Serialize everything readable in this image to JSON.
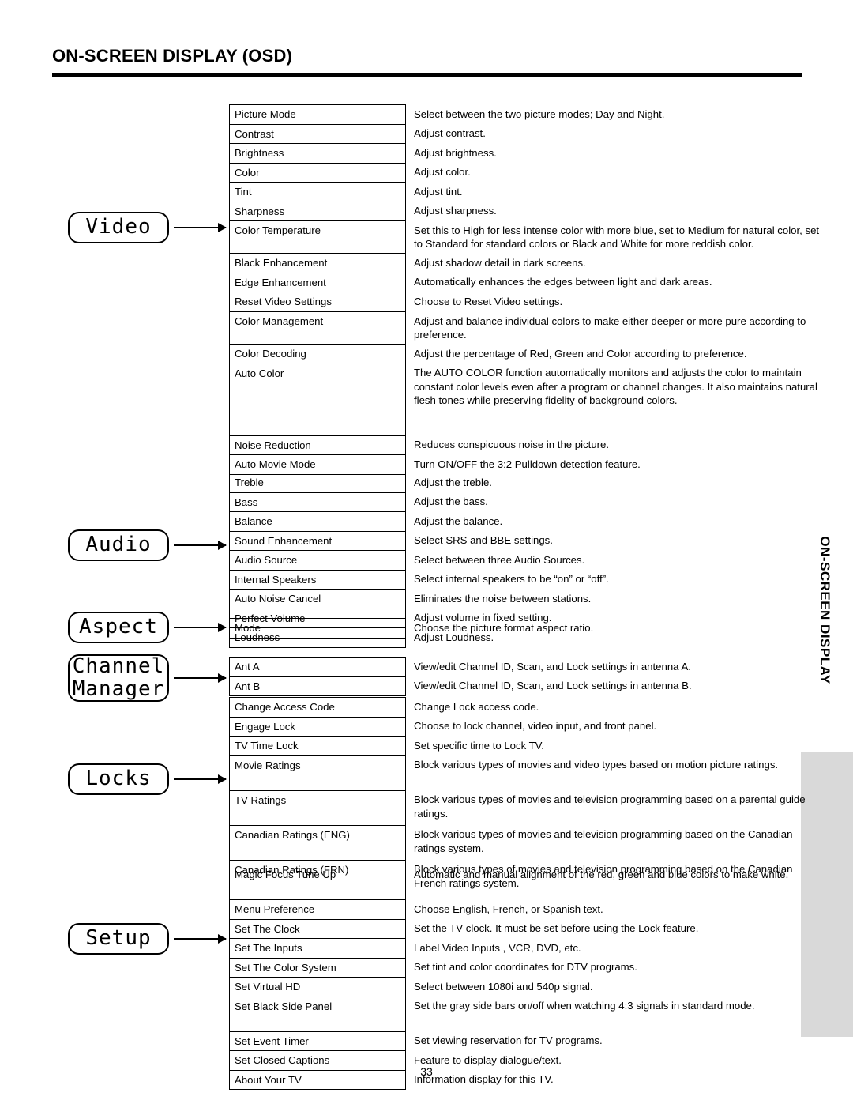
{
  "header": {
    "title": "ON-SCREEN DISPLAY (OSD)"
  },
  "side_tab": {
    "label": "ON-SCREEN DISPLAY"
  },
  "page_number": "33",
  "categories": [
    {
      "label": "Video"
    },
    {
      "label": "Audio"
    },
    {
      "label": "Aspect"
    },
    {
      "label": "Channel\nManager"
    },
    {
      "label": "Locks"
    },
    {
      "label": "Setup"
    }
  ],
  "sections": [
    {
      "category": "Video",
      "rows": [
        {
          "name": "Picture Mode",
          "desc": "Select between the two picture modes; Day and Night."
        },
        {
          "name": "Contrast",
          "desc": "Adjust contrast."
        },
        {
          "name": "Brightness",
          "desc": "Adjust brightness."
        },
        {
          "name": "Color",
          "desc": "Adjust color."
        },
        {
          "name": "Tint",
          "desc": "Adjust tint."
        },
        {
          "name": "Sharpness",
          "desc": "Adjust sharpness."
        },
        {
          "name": "Color Temperature",
          "desc": "Set this to High for less intense color with more blue, set to Medium for natural color, set to Standard for standard colors or Black and White for more reddish color."
        },
        {
          "name": "Black Enhancement",
          "desc": "Adjust shadow detail in dark screens."
        },
        {
          "name": "Edge Enhancement",
          "desc": "Automatically enhances the edges between light and dark areas."
        },
        {
          "name": "Reset Video Settings",
          "desc": "Choose to Reset Video settings."
        },
        {
          "name": "Color Management",
          "desc": "Adjust and balance individual colors to make either deeper or more pure according to preference."
        },
        {
          "name": "Color Decoding",
          "desc": "Adjust the percentage of Red, Green and Color according to preference."
        },
        {
          "name": "Auto Color",
          "desc": "The AUTO COLOR function automatically monitors and adjusts the color to maintain constant color levels even after a program or channel changes. It also maintains natural flesh tones while preserving fidelity of background colors."
        },
        {
          "name": "Noise Reduction",
          "desc": "Reduces conspicuous noise in the picture."
        },
        {
          "name": "Auto Movie Mode",
          "desc": "Turn ON/OFF the 3:2 Pulldown detection feature."
        }
      ]
    },
    {
      "category": "Audio",
      "rows": [
        {
          "name": "Treble",
          "desc": "Adjust the treble."
        },
        {
          "name": "Bass",
          "desc": "Adjust the bass."
        },
        {
          "name": "Balance",
          "desc": "Adjust the balance."
        },
        {
          "name": "Sound Enhancement",
          "desc": "Select SRS and BBE settings."
        },
        {
          "name": "Audio Source",
          "desc": "Select between three Audio Sources."
        },
        {
          "name": "Internal Speakers",
          "desc": "Select internal speakers to be “on” or “off”."
        },
        {
          "name": "Auto Noise Cancel",
          "desc": "Eliminates the noise between stations."
        },
        {
          "name": "Perfect Volume",
          "desc": "Adjust volume in fixed setting."
        },
        {
          "name": "Loudness",
          "desc": "Adjust Loudness."
        }
      ]
    },
    {
      "category": "Aspect",
      "rows": [
        {
          "name": "Mode",
          "desc": "Choose the picture format aspect ratio."
        }
      ]
    },
    {
      "category": "Channel Manager",
      "rows": [
        {
          "name": "Ant A",
          "desc": "View/edit Channel ID, Scan, and Lock settings in antenna A."
        },
        {
          "name": "Ant B",
          "desc": "View/edit Channel ID, Scan, and Lock settings in antenna B."
        }
      ]
    },
    {
      "category": "Locks",
      "rows": [
        {
          "name": "Change Access Code",
          "desc": "Change Lock access code."
        },
        {
          "name": "Engage Lock",
          "desc": "Choose to lock channel, video input, and front panel."
        },
        {
          "name": "TV Time Lock",
          "desc": "Set specific time to Lock TV."
        },
        {
          "name": "Movie Ratings",
          "desc": "Block various types of movies and video types based on motion picture ratings."
        },
        {
          "name": "TV Ratings",
          "desc": "Block various types of movies and television programming based on a parental guide ratings."
        },
        {
          "name": "Canadian Ratings (ENG)",
          "desc": "Block various types of movies and television programming based on the Canadian ratings system."
        },
        {
          "name": "Canadian Ratings (FRN)",
          "desc": "Block various types of movies and television programming based on the Canadian French ratings system."
        }
      ]
    },
    {
      "category": "Setup",
      "rows": [
        {
          "name": "Magic Focus Tune Up",
          "desc": "Automatic and manual alignment of the red, green and blue colors to make white."
        },
        {
          "name": "Menu Preference",
          "desc": "Choose English, French, or Spanish text."
        },
        {
          "name": "Set The Clock",
          "desc": "Set the TV clock.  It must be set before using the Lock feature."
        },
        {
          "name": "Set The Inputs",
          "desc": "Label Video Inputs , VCR, DVD, etc."
        },
        {
          "name": "Set The Color System",
          "desc": "Set tint and color coordinates for DTV programs."
        },
        {
          "name": "Set Virtual HD",
          "desc": "Select between 1080i and 540p signal."
        },
        {
          "name": "Set Black Side Panel",
          "desc": "Set the gray side bars on/off when watching 4:3 signals in standard mode."
        },
        {
          "name": "Set Event Timer",
          "desc": "Set viewing reservation for TV programs."
        },
        {
          "name": "Set Closed Captions",
          "desc": "Feature to display dialogue/text."
        },
        {
          "name": "About Your TV",
          "desc": "Information display for this TV."
        }
      ]
    }
  ]
}
